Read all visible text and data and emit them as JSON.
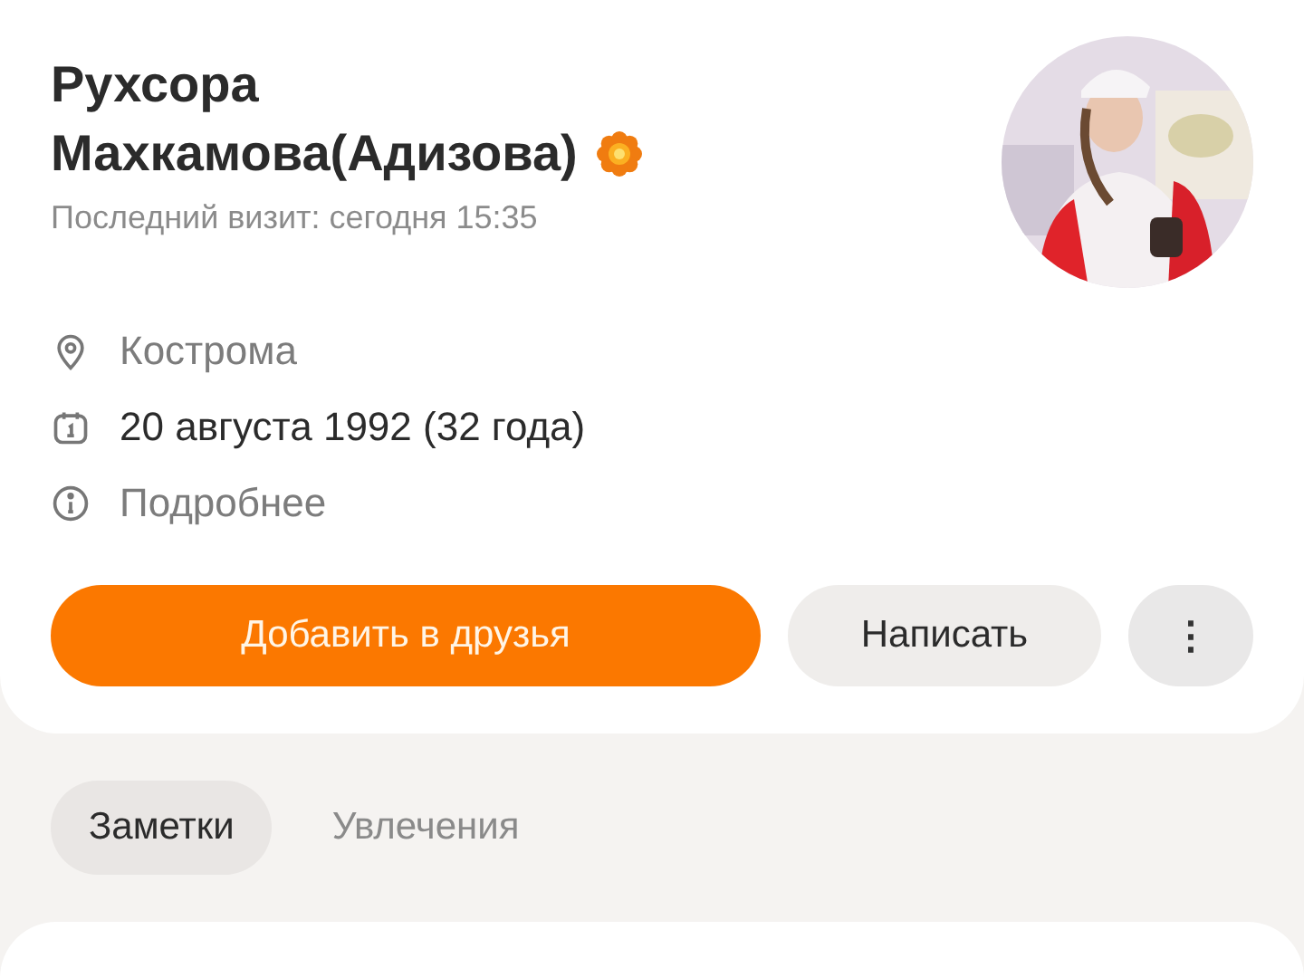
{
  "profile": {
    "name_line_1": "Рухсора",
    "name_line_2": "Махкамова(Адизова)",
    "last_visit": "Последний визит: сегодня 15:35",
    "details": [
      {
        "kind": "location",
        "text": "Кострома",
        "muted": true
      },
      {
        "kind": "birthday",
        "text": "20 августа 1992 (32 года)",
        "muted": false
      },
      {
        "kind": "info",
        "text": "Подробнее",
        "muted": true
      }
    ],
    "actions": [
      {
        "kind": "primary",
        "label": "Добавить в друзья"
      },
      {
        "kind": "secondary",
        "label": "Написать"
      },
      {
        "kind": "more",
        "label": "⋮"
      }
    ]
  },
  "tabs": [
    {
      "label": "Заметки",
      "selected": true
    },
    {
      "label": "Увлечения",
      "selected": false
    }
  ]
}
